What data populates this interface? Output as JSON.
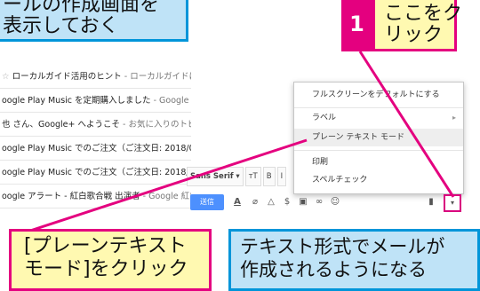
{
  "callouts": {
    "top_left_line1": "ールの作成画面を",
    "top_left_line2": "表示しておく",
    "step_number": "1",
    "step_line1": "ここをク",
    "step_line2": "リック",
    "bottom_left_line1": "[プレーンテキスト",
    "bottom_left_line2": "モード]をクリック",
    "bottom_right_line1": "テキスト形式でメールが",
    "bottom_right_line2": "作成されるようになる"
  },
  "inbox": {
    "rows": [
      {
        "subject": "ローカルガイド活用のヒント",
        "snippet": " - ローカルガイドにご参"
      },
      {
        "subject": "oogle Play Music を定期購入しました",
        "snippet": " - Google Play Go"
      },
      {
        "subject": "也 さん、Google+ へようこそ",
        "snippet": " - お気に入りのトピック"
      },
      {
        "subject": "oogle Play Music でのご注文（ご注文日: 2018/01/11）",
        "snippet": " -"
      },
      {
        "subject": "oogle Play Music でのご注文（ご注文日: 2018/01/11）",
        "snippet": " -"
      },
      {
        "subject": "oogle アラート - 紅白歌合戦 出演者",
        "snippet": " - Google 紅白歌合"
      }
    ]
  },
  "compose": {
    "font_label": "Sans Serif",
    "size_label": "тT",
    "bold_label": "B",
    "italic_label": "I",
    "send_label": "送信",
    "more_label": "▾"
  },
  "menu": {
    "item_fullscreen": "フルスクリーンをデフォルトにする",
    "item_label": "ラベル",
    "item_plaintext": "プレーン テキスト モード",
    "item_print": "印刷",
    "item_spellcheck": "スペルチェック",
    "submenu_arrow": "▸"
  },
  "colors": {
    "accent_pink": "#e4007f",
    "callout_blue_border": "#0095d9",
    "callout_blue_fill": "#bfe3f7",
    "callout_yellow_fill": "#fff9b1",
    "send_button": "#4d90fe"
  }
}
